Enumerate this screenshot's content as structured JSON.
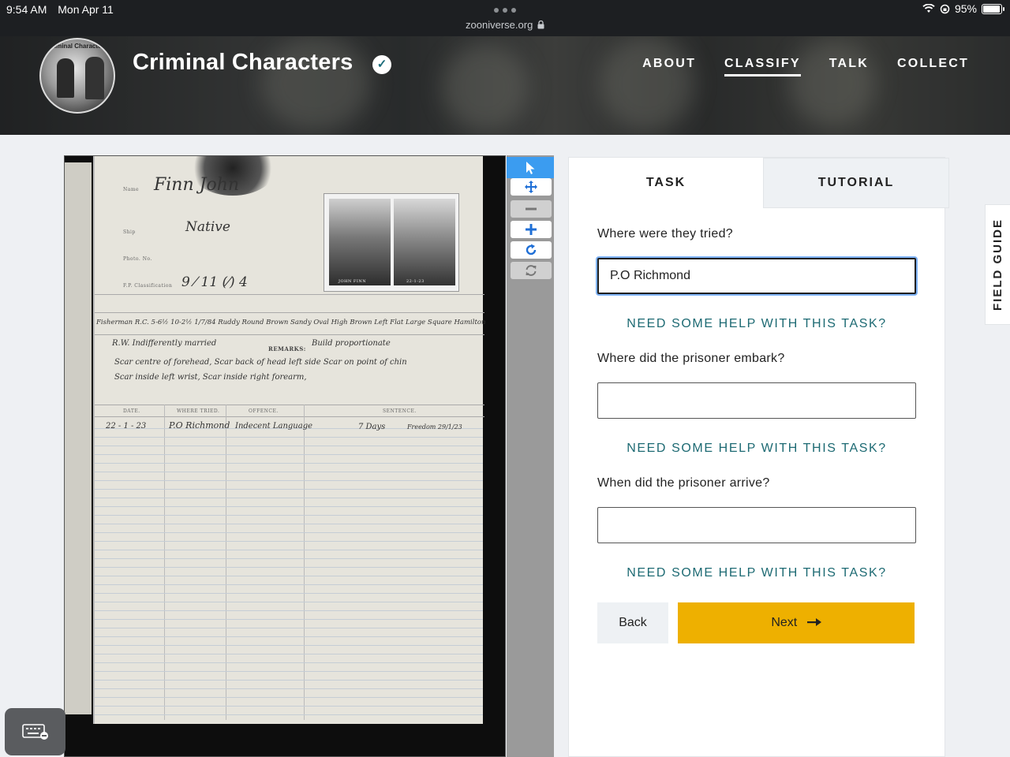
{
  "status_bar": {
    "time": "9:54 AM",
    "date": "Mon Apr 11",
    "url": "zooniverse.org",
    "battery": "95%",
    "battery_level": 0.95
  },
  "header": {
    "avatar_text": "Criminal Characters",
    "title": "Criminal Characters",
    "nav": [
      "ABOUT",
      "CLASSIFY",
      "TALK",
      "COLLECT"
    ],
    "active_nav": "CLASSIFY"
  },
  "subject": {
    "name_label": "Name",
    "name_value": "Finn John",
    "ship_label": "Ship",
    "ship_value": "Native",
    "photo_label": "Photo. No.",
    "fp_label": "F.P. Classification",
    "remarks_label": "REMARKS:",
    "row1": "Fisherman  R.C.  5-6½  10-2½  1/7/84  Ruddy  Round  Brown  Sandy  Oval  High  Brown  Left  Flat  Large  Square  Hamilton",
    "row2": "R.W.  Indifferently  married",
    "remarks_value": "Build proportionate",
    "marks1": "Scar centre of forehead,  Scar back of head left side  Scar on point of chin",
    "marks2": "Scar inside left wrist,   Scar inside right forearm,",
    "col_date": "DATE.",
    "col_where": "WHERE TRIED.",
    "col_offence": "OFFENCE.",
    "col_sentence": "SENTENCE.",
    "entry_date": "22 - 1 - 23",
    "entry_where": "P.O Richmond",
    "entry_offence": "Indecent Language",
    "entry_sentence": "7 Days",
    "entry_note": "Freedom 29/1/23",
    "photo_caption_left": "JOHN FINN",
    "photo_caption_right": "22-1-23"
  },
  "task_panel": {
    "tab_task": "TASK",
    "tab_tutorial": "TUTORIAL",
    "q1_label": "Where were they tried?",
    "q1_value": "P.O Richmond",
    "q2_label": "Where did the prisoner embark?",
    "q2_value": "",
    "q3_label": "When did the prisoner arrive?",
    "q3_value": "",
    "help_text": "NEED SOME HELP WITH THIS TASK?",
    "back_label": "Back",
    "next_label": "Next"
  },
  "field_guide_label": "FIELD GUIDE",
  "colors": {
    "accent_teal": "#1d6a73",
    "next_yellow": "#eeb000",
    "toolbar_active": "#3b9cf0"
  }
}
